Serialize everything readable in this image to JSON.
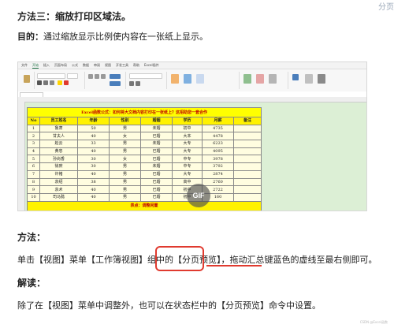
{
  "corner_text": "分页",
  "heading_method3": "方法三：缩放打印区域法。",
  "goal_label": "目的：",
  "goal_text": "通过缩放显示比例使内容在一张纸上显示。",
  "excel": {
    "tabs": [
      "文件",
      "开始",
      "插入",
      "页面布局",
      "公式",
      "数据",
      "审阅",
      "视图",
      "开发工具",
      "帮助",
      "Excel插件"
    ],
    "active_tab": "开始",
    "title_text": "Excel函数公式：如何将大文档内容打印在一张纸上？这招助您一套合作",
    "headers": [
      "No",
      "员工姓名",
      "年龄",
      "性别",
      "婚姻",
      "学历",
      "月薪",
      "备注"
    ],
    "rows": [
      [
        "1",
        "鲁肃",
        "50",
        "男",
        "未婚",
        "初中",
        "4735",
        ""
      ],
      [
        "2",
        "甘夫人",
        "40",
        "女",
        "已婚",
        "大本",
        "4478",
        ""
      ],
      [
        "3",
        "赵云",
        "33",
        "男",
        "未婚",
        "大专",
        "6223",
        ""
      ],
      [
        "4",
        "黄忠",
        "40",
        "男",
        "已婚",
        "大专",
        "4095",
        ""
      ],
      [
        "5",
        "孙尚香",
        "30",
        "女",
        "已婚",
        "中专",
        "3978",
        ""
      ],
      [
        "6",
        "徐庶",
        "30",
        "男",
        "未婚",
        "中专",
        "3792",
        ""
      ],
      [
        "7",
        "许褚",
        "40",
        "男",
        "已婚",
        "大专",
        "2874",
        ""
      ],
      [
        "8",
        "袁绍",
        "38",
        "男",
        "已婚",
        "高中",
        "2760",
        ""
      ],
      [
        "9",
        "袁术",
        "40",
        "男",
        "已婚",
        "初中",
        "2722",
        ""
      ],
      [
        "10",
        "司马懿",
        "40",
        "男",
        "已婚",
        "初中",
        "160",
        ""
      ]
    ],
    "footer_text": "表点：调整闲置"
  },
  "gif_badge": "GIF",
  "method_label": "方法：",
  "instr_part1": "单击【视图】菜单【工作簿视图】组中的",
  "instr_box": "【分页预览】",
  "instr_part2": "，拖动汇总键蓝色的虚线至最右侧即可。",
  "explain_label": "解读：",
  "explain_text": "除了在【视图】菜单中调整外，也可以在状态栏中的【分页预览】命令中设置。",
  "watermark": "CSDN @Excel函数"
}
